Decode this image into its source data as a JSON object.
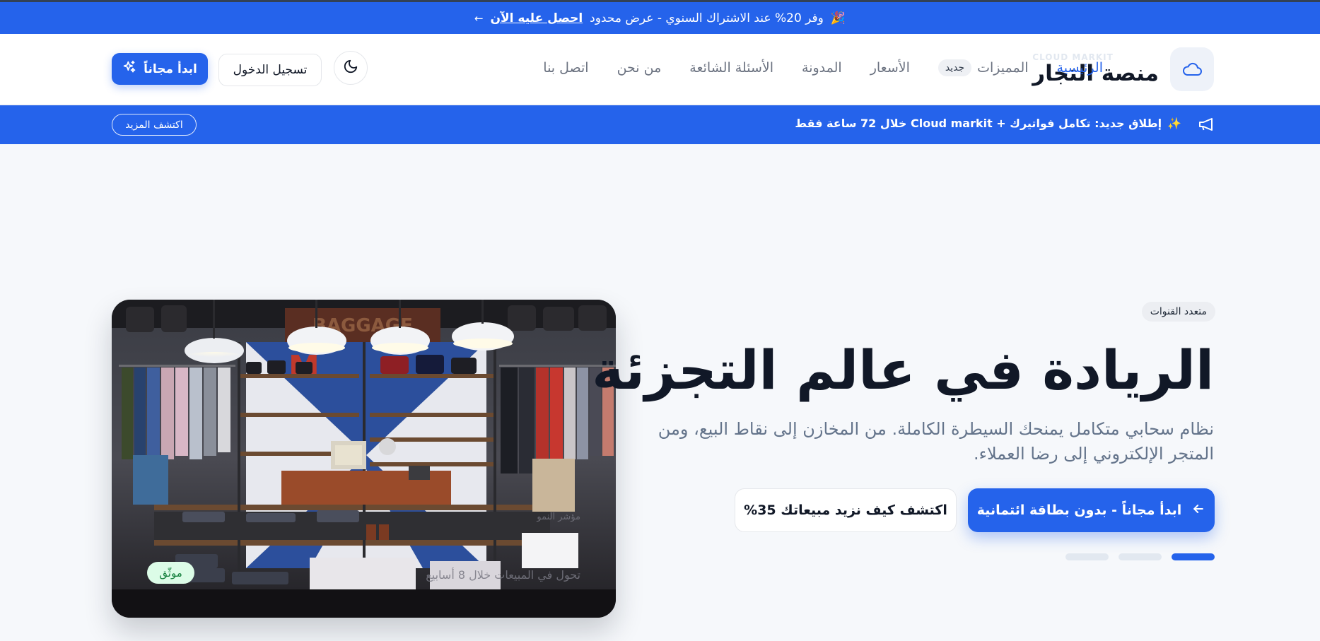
{
  "promo": {
    "emoji": "🎉",
    "text": "وفر 20% عند الاشتراك السنوي - عرض محدود",
    "link": "احصل عليه الآن",
    "arrow": "←"
  },
  "header": {
    "brand_sub": "CLOUD MARKIT",
    "brand_name": "منصة التجار",
    "nav": [
      "الرئيسية",
      "المميزات",
      "الأسعار",
      "المدونة",
      "الأسئلة الشائعة",
      "من نحن",
      "اتصل بنا"
    ],
    "nav_badge": "جديد",
    "login_label": "تسجيل الدخول",
    "start_label": "ابدأ مجاناً"
  },
  "announcement": {
    "emoji": "✨",
    "text": "إطلاق جديد: تكامل فواتيرك + Cloud markit خلال 72 ساعة فقط",
    "more_label": "اكتشف المزيد"
  },
  "hero": {
    "chip": "متعدد القنوات",
    "title": "الريادة في عالم التجزئة",
    "description": "نظام سحابي متكامل يمنحك السيطرة الكاملة. من المخازن إلى نقاط البيع، ومن المتجر الإلكتروني إلى رضا العملاء.",
    "primary_cta": "ابدأ مجاناً - بدون بطاقة ائتمانية",
    "secondary_cta": "اكتشف كيف نزيد مبيعاتك 35%",
    "image_overlay_small": "مؤشر النمو",
    "image_overlay_caption": "تحول في المبيعات خلال 8 أسابيع",
    "trust_badge": "موثّق",
    "slides_total": 3,
    "slide_active": 1
  },
  "colors": {
    "accent": "#2563eb",
    "title": "#111827",
    "muted": "#64748b",
    "success": "#15803d"
  }
}
